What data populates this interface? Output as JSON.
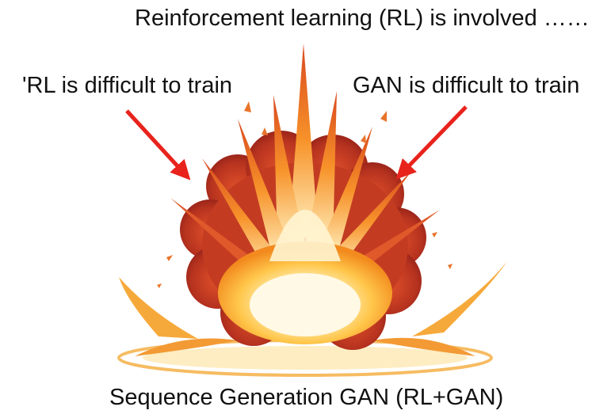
{
  "slide": {
    "title": "Reinforcement learning (RL) is involved ……",
    "label_left": "'RL is difficult to train",
    "label_right": "GAN is difficult to train",
    "caption": "Sequence Generation GAN (RL+GAN)"
  },
  "colors": {
    "arrow": "#e8231c",
    "smoke_dark": "#b83322",
    "fire_orange": "#f07a1e",
    "fire_yellow": "#ffd24a",
    "core": "#fff6d8"
  },
  "icons": {
    "illustration": "explosion-illustration"
  }
}
